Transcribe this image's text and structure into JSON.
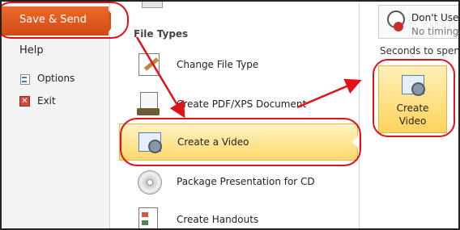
{
  "nav": {
    "active_label": "Save & Send",
    "help_label": "Help",
    "items": [
      {
        "label": "Options",
        "icon": "options-icon"
      },
      {
        "label": "Exit",
        "icon": "exit-icon"
      }
    ]
  },
  "file_types": {
    "title": "File Types",
    "items": [
      {
        "label": "Change File Type",
        "icon": "change-file-type-icon"
      },
      {
        "label": "Create PDF/XPS Document",
        "icon": "pdf-document-icon"
      },
      {
        "label": "Create a Video",
        "icon": "video-icon",
        "selected": true
      },
      {
        "label": "Package Presentation for CD",
        "icon": "cd-icon"
      },
      {
        "label": "Create Handouts",
        "icon": "handouts-icon"
      }
    ]
  },
  "right_panel": {
    "duration_line1": "Don't Use R",
    "duration_line2": "No timings",
    "seconds_text": "Seconds to spend o",
    "create_video_line1": "Create",
    "create_video_line2": "Video"
  },
  "colors": {
    "accent_orange": "#d14a14",
    "selection_yellow": "#ffd86b",
    "annotation_red": "#e0121a"
  }
}
